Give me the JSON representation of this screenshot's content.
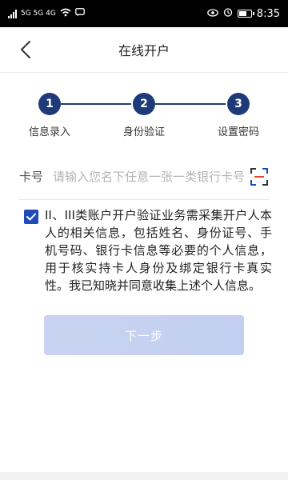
{
  "status_bar": {
    "left_text": "5G 5G 4G",
    "time": "8:35",
    "battery_percent": 0.7
  },
  "header": {
    "title": "在线开户"
  },
  "steps": [
    {
      "number": "1",
      "label": "信息录入"
    },
    {
      "number": "2",
      "label": "身份验证"
    },
    {
      "number": "3",
      "label": "设置密码"
    }
  ],
  "card_field": {
    "label": "卡号",
    "placeholder": "请输入您名下任意一张一类银行卡号"
  },
  "consent": {
    "checked": true,
    "text": "II、III类账户开户验证业务需采集开户人本人的相关信息，包括姓名、身份证号、手机号码、银行卡信息等必要的个人信息，用于核实持卡人身份及绑定银行卡真实性。我已知晓并同意收集上述个人信息。"
  },
  "next_button": {
    "label": "下一步"
  },
  "colors": {
    "primary": "#1f3a78",
    "checkbox": "#1f4bb8",
    "button_disabled": "#c5d0f0"
  },
  "icons": {
    "back": "chevron-left-icon",
    "scan": "scan-icon",
    "check": "check-icon"
  }
}
